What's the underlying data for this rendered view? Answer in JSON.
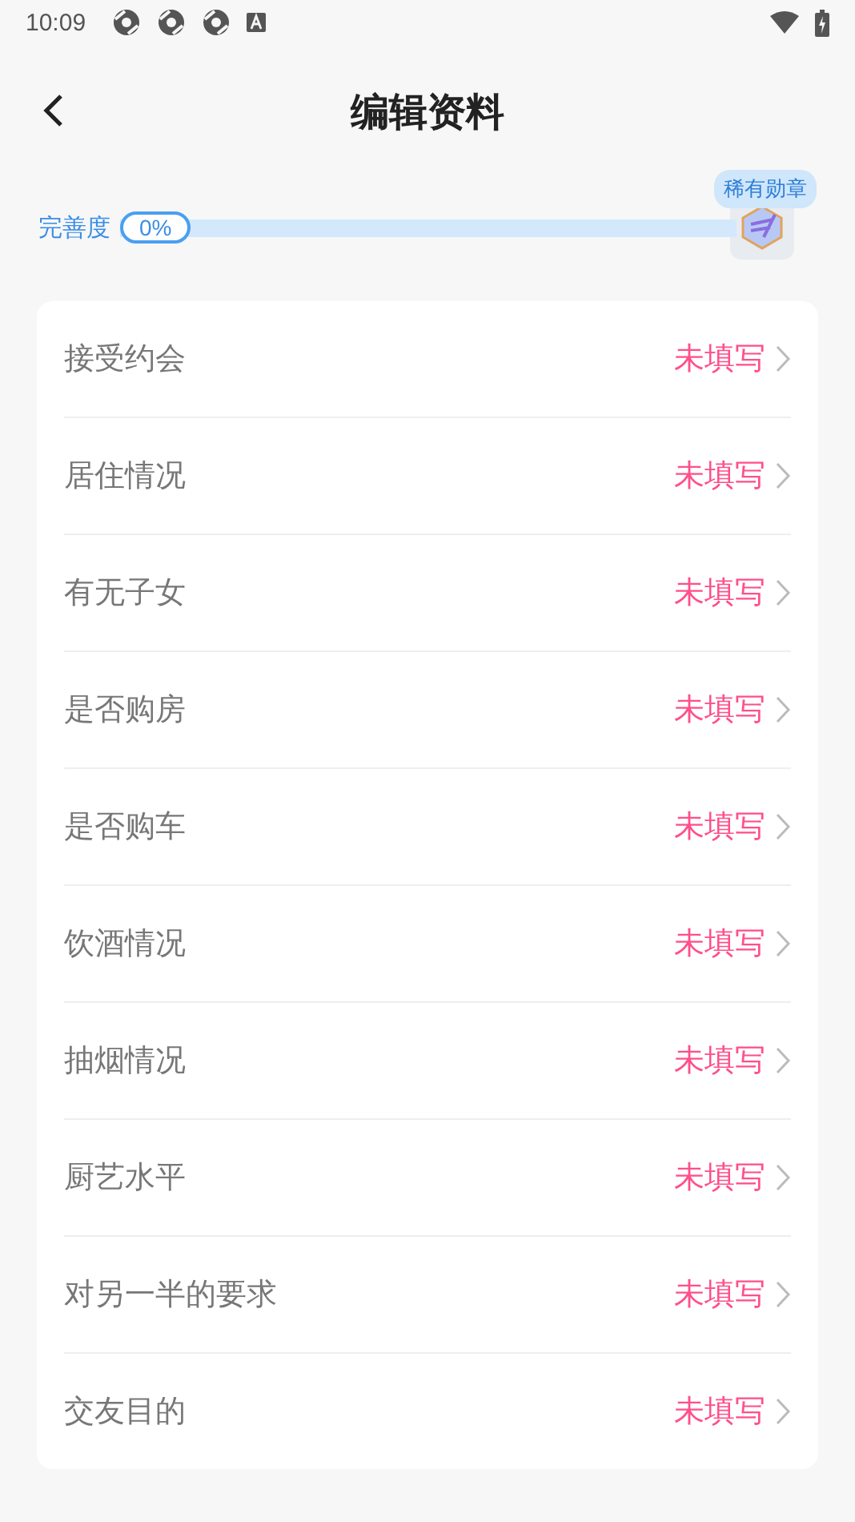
{
  "status_bar": {
    "time": "10:09"
  },
  "header": {
    "title": "编辑资料"
  },
  "progress": {
    "label": "完善度",
    "reading": "0%",
    "badge_tooltip": "稀有勋章"
  },
  "fields": [
    {
      "label": "接受约会",
      "value": "未填写"
    },
    {
      "label": "居住情况",
      "value": "未填写"
    },
    {
      "label": "有无子女",
      "value": "未填写"
    },
    {
      "label": "是否购房",
      "value": "未填写"
    },
    {
      "label": "是否购车",
      "value": "未填写"
    },
    {
      "label": "饮酒情况",
      "value": "未填写"
    },
    {
      "label": "抽烟情况",
      "value": "未填写"
    },
    {
      "label": "厨艺水平",
      "value": "未填写"
    },
    {
      "label": "对另一半的要求",
      "value": "未填写"
    },
    {
      "label": "交友目的",
      "value": "未填写"
    }
  ]
}
